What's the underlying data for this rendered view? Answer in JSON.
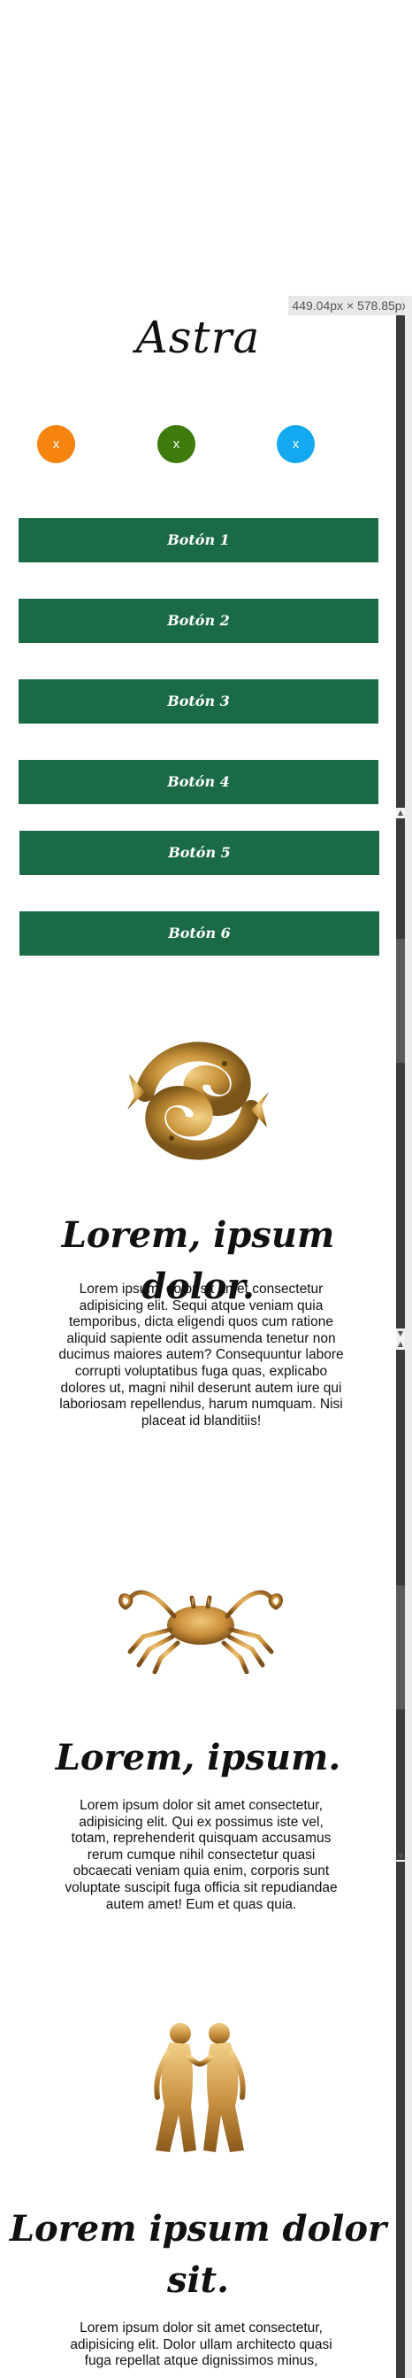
{
  "overlay": {
    "dimensions": "449.04px × 578.85px"
  },
  "header": {
    "title": "Astra"
  },
  "social": [
    {
      "label": "x",
      "color": "#f5840f"
    },
    {
      "label": "x",
      "color": "#3e7a0c"
    },
    {
      "label": "x",
      "color": "#13a8f0"
    }
  ],
  "buttons": [
    "Botón 1",
    "Botón 2",
    "Botón 3",
    "Botón 4",
    "Botón 5",
    "Botón 6"
  ],
  "sections": [
    {
      "icon": "pisces-icon",
      "title": "Lorem, ipsum dolor.",
      "lines": [
        "Lorem ipsum, dolor sit amet consectetur",
        "adipisicing elit. Sequi atque veniam quia",
        "temporibus, dicta eligendi quos cum ratione",
        "aliquid sapiente odit assumenda tenetur non",
        "ducimus maiores autem? Consequuntur labore",
        "corrupti voluptatibus fuga quas, explicabo",
        "dolores ut, magni nihil deserunt autem iure qui",
        "laboriosam repellendus, harum numquam. Nisi",
        "placeat id blanditiis!"
      ]
    },
    {
      "icon": "cancer-crab-icon",
      "title": "Lorem, ipsum.",
      "lines": [
        "Lorem ipsum dolor sit amet consectetur,",
        "adipisicing elit. Qui ex possimus iste vel,",
        "totam, reprehenderit quisquam accusamus",
        "rerum cumque nihil consectetur quasi",
        "obcaecati veniam quia enim, corporis sunt",
        "voluptate suscipit fuga officia sit repudiandae",
        "autem amet! Eum et quas quia."
      ]
    },
    {
      "icon": "gemini-icon",
      "title_lines": [
        "Lorem ipsum dolor",
        "sit."
      ],
      "lines": [
        "Lorem ipsum dolor sit amet consectetur,",
        "adipisicing elit. Dolor ullam architecto quasi",
        "fuga repellat atque dignissimos minus,"
      ]
    }
  ],
  "colors": {
    "button_green": "#1b6a46",
    "gold": "#c9953c",
    "scrollbar_thumb": "#3b3b3b"
  }
}
